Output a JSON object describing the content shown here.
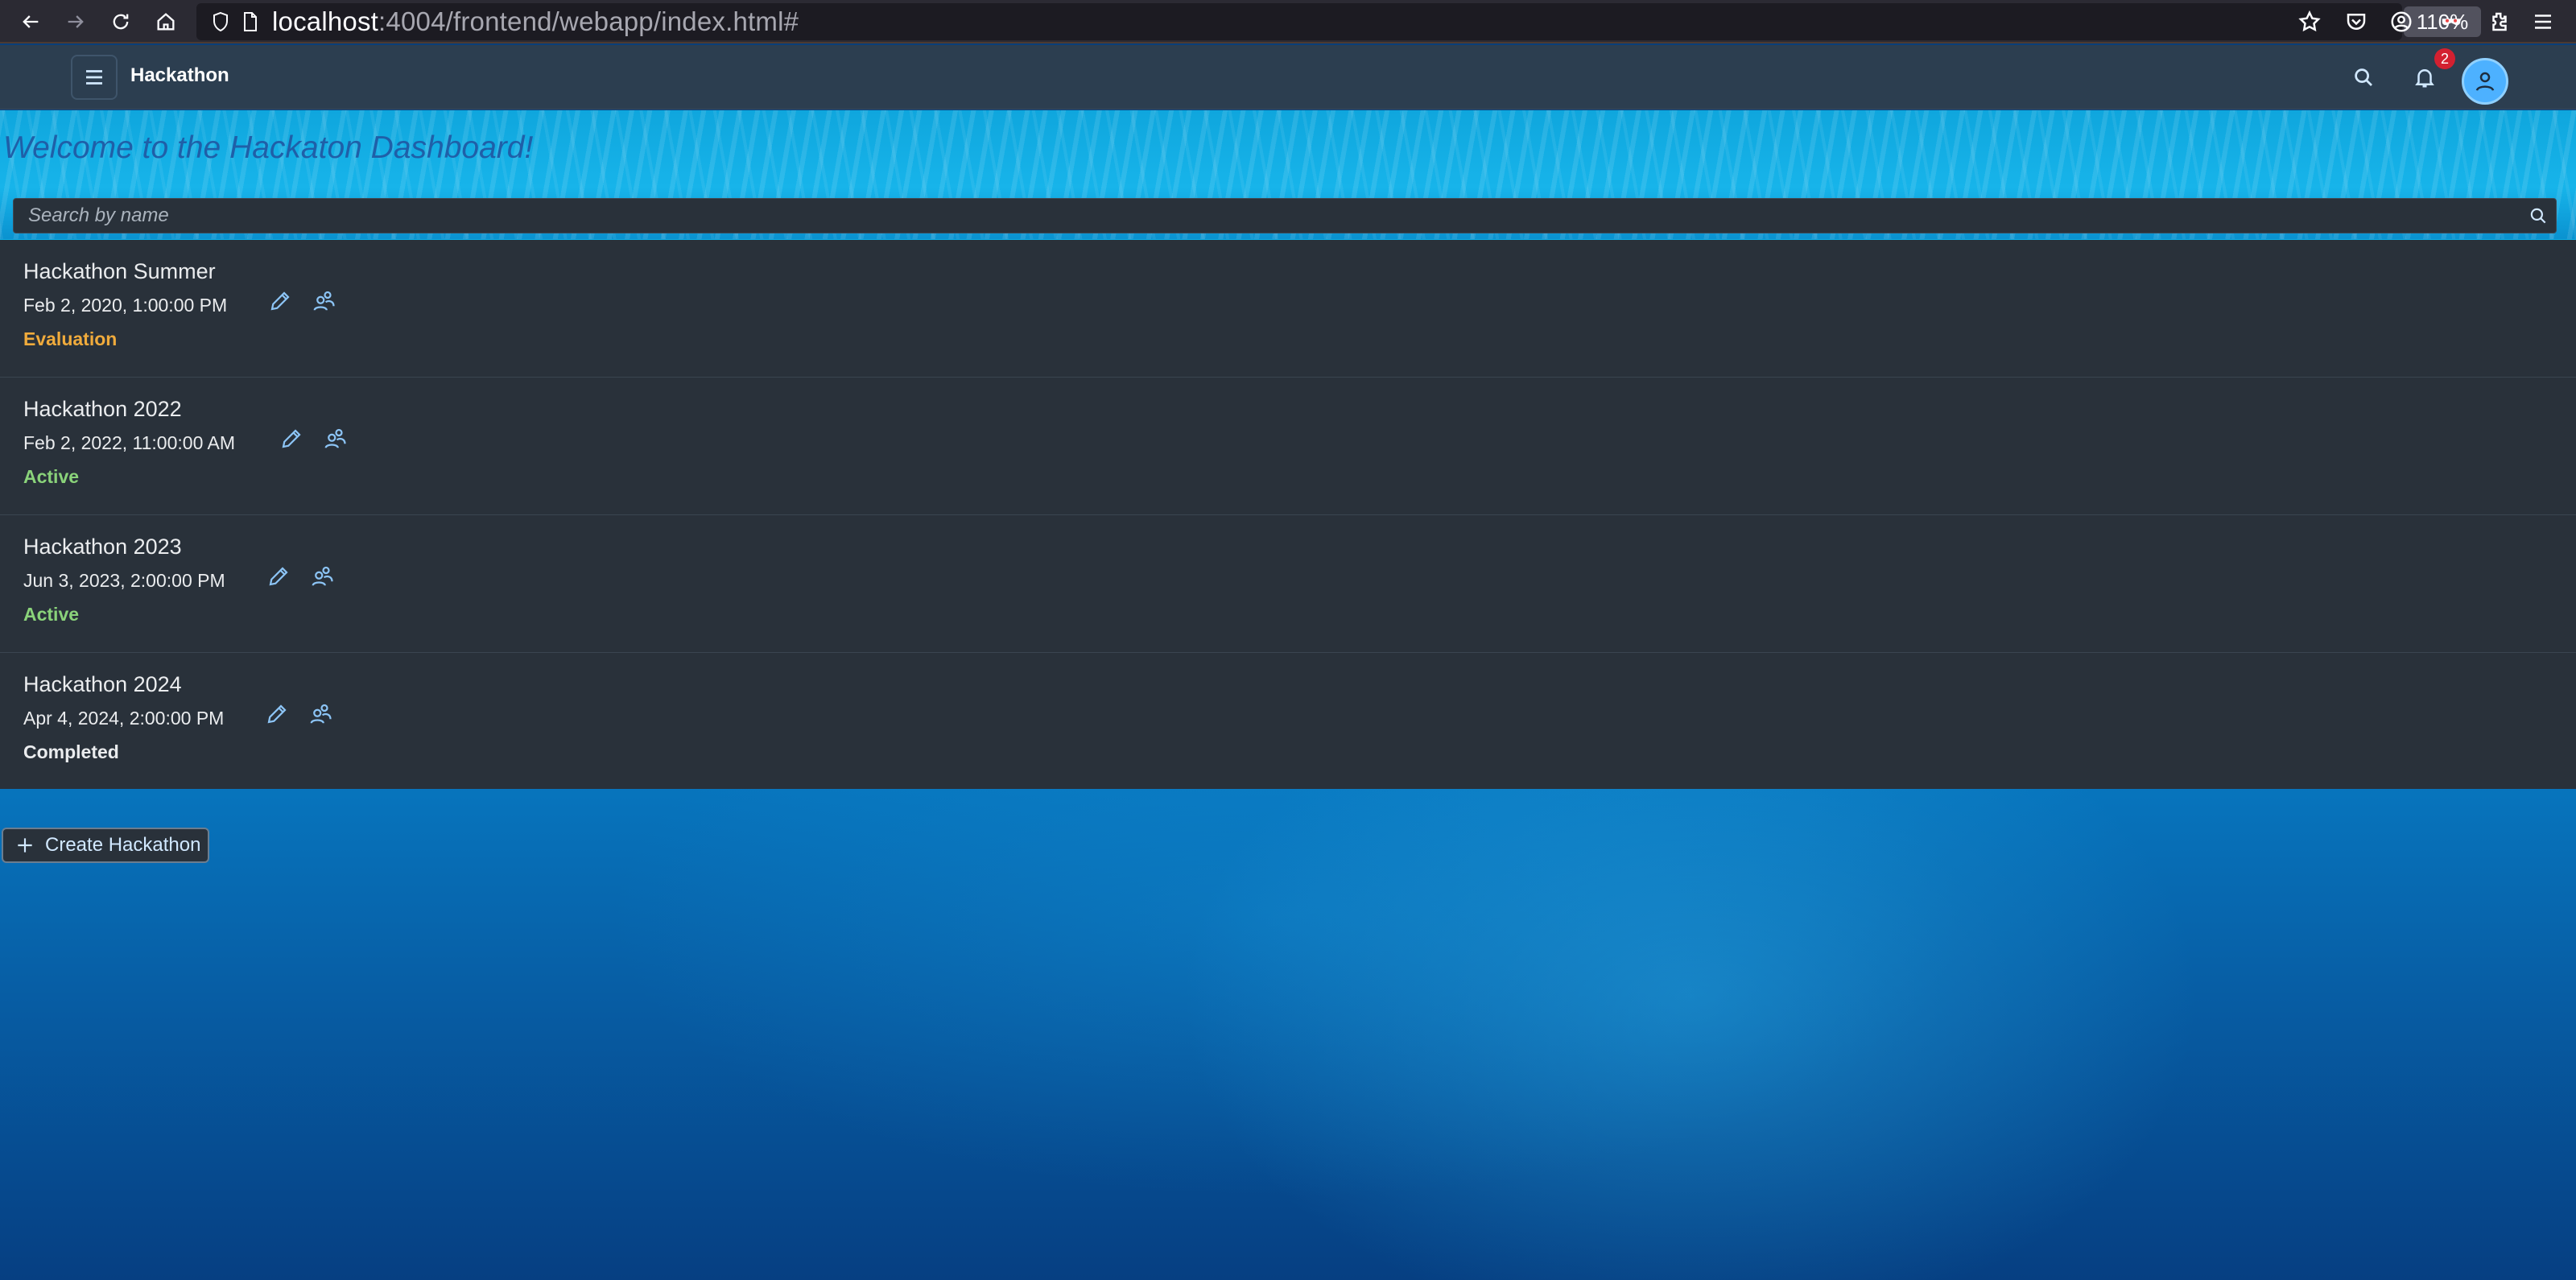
{
  "browser": {
    "url_host": "localhost",
    "url_port_path": ":4004/frontend/webapp/index.html#",
    "zoom": "110%"
  },
  "shell": {
    "title": "Hackathon",
    "notification_count": "2"
  },
  "page": {
    "title": "Welcome to the Hackaton Dashboard!",
    "search_placeholder": "Search by name"
  },
  "hackathons": [
    {
      "name": "Hackathon Summer",
      "date": "Feb 2, 2020, 1:00:00 PM",
      "status": "Evaluation"
    },
    {
      "name": "Hackathon 2022",
      "date": "Feb 2, 2022, 11:00:00 AM",
      "status": "Active"
    },
    {
      "name": "Hackathon 2023",
      "date": "Jun 3, 2023, 2:00:00 PM",
      "status": "Active"
    },
    {
      "name": "Hackathon 2024",
      "date": "Apr 4, 2024, 2:00:00 PM",
      "status": "Completed"
    }
  ],
  "actions": {
    "create_label": "Create Hackathon"
  },
  "colors": {
    "status_evaluation": "#f0ab3c",
    "status_active": "#8ad37a",
    "status_completed": "#eaecee",
    "shell_bg": "#2c3e50",
    "list_bg": "#29313a"
  }
}
